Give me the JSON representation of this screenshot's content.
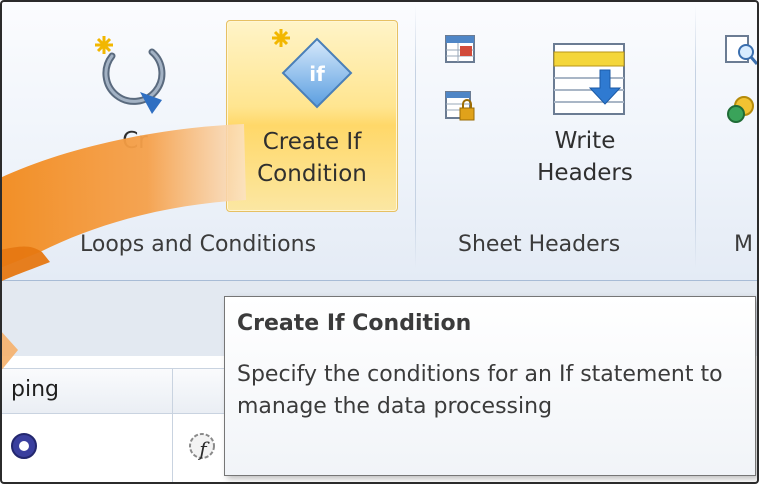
{
  "ribbon": {
    "groups": [
      {
        "label": "Loops and Conditions",
        "buttons": [
          {
            "label_line1": "Cr",
            "label_line2": "",
            "icon": "loop-icon"
          },
          {
            "label_line1": "Create If",
            "label_line2": "Condition",
            "icon": "if-condition-icon",
            "state": "hover"
          }
        ]
      },
      {
        "label": "Sheet Headers",
        "buttons": [
          {
            "icon": "sheet-table-icon"
          },
          {
            "icon": "sheet-lock-icon"
          },
          {
            "label_line1": "Write",
            "label_line2": "Headers",
            "icon": "write-headers-icon"
          }
        ]
      },
      {
        "label": "M",
        "buttons": [
          {
            "icon": "search-sheet-icon"
          },
          {
            "icon": "refresh-coins-icon"
          }
        ]
      }
    ]
  },
  "grid": {
    "header_label": "ping"
  },
  "tooltip": {
    "title": "Create If Condition",
    "description": "Specify the conditions for an If statement to manage the data processing"
  },
  "colors": {
    "hover_fill": "#ffe590",
    "arrow_orange": "#f28a1c",
    "ribbon_bg": "#eef3fa"
  }
}
